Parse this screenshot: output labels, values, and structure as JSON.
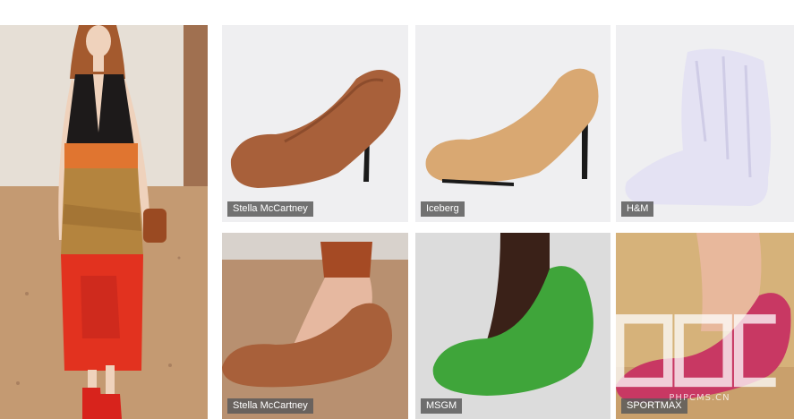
{
  "tiles": [
    {
      "brand": "Stella McCartney"
    },
    {
      "brand": "Iceberg"
    },
    {
      "brand": "H&M"
    },
    {
      "brand": "Stella McCartney"
    },
    {
      "brand": "MSGM"
    },
    {
      "brand": "SPORTMAX"
    }
  ],
  "watermark": {
    "text": "PHPCMS.CN"
  },
  "colors": {
    "caption_bg": "#5a5a5a",
    "fur_brown": "#a8603a",
    "fur_tan": "#d9a872",
    "fur_lilac": "#e4e2f3",
    "fur_green": "#3fa53a",
    "fur_pink": "#c83863",
    "runway_sand": "#c49a72"
  }
}
